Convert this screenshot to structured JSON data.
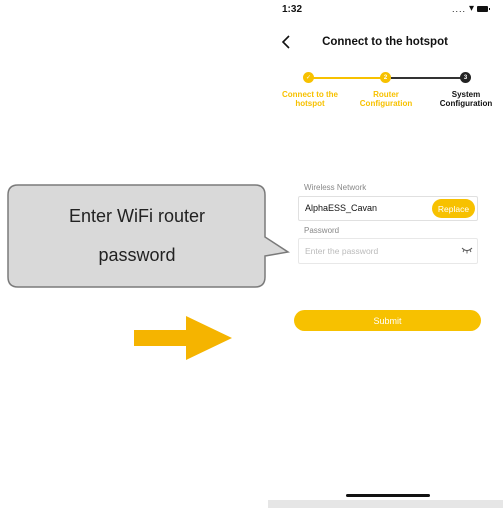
{
  "status_bar": {
    "time": "1:32",
    "signal": "....",
    "wifi_icon": "wifi-icon",
    "battery_icon": "battery-icon"
  },
  "nav": {
    "title": "Connect to the hotspot",
    "back_icon": "back-chevron-icon"
  },
  "steps": [
    {
      "label": "Connect to the hotspot",
      "state": "done",
      "marker": "✓"
    },
    {
      "label": "Router Configuration",
      "state": "done",
      "marker": "2"
    },
    {
      "label": "System Configuration",
      "state": "current",
      "marker": "3"
    }
  ],
  "form": {
    "wireless_label": "Wireless Network",
    "network_value": "AlphaESS_Cavan",
    "replace_label": "Replace",
    "password_label": "Password",
    "password_placeholder": "Enter the password",
    "password_value": "",
    "submit_label": "Submit"
  },
  "callout": {
    "line1": "Enter WiFi router",
    "line2": "password"
  },
  "colors": {
    "accent": "#f7c100",
    "callout_fill": "#d9d9d9",
    "arrow": "#f5b400",
    "text_dark": "#111111"
  }
}
